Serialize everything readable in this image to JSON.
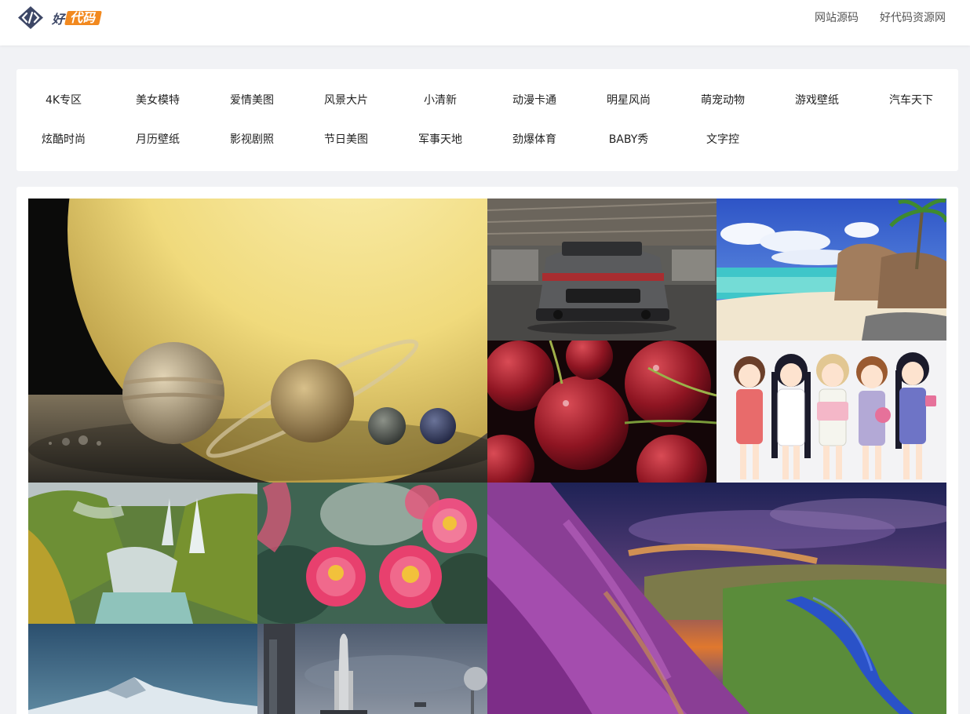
{
  "header": {
    "logo_part1": "好",
    "logo_part2": "代码",
    "nav": [
      "网站源码",
      "好代码资源网"
    ]
  },
  "categories": [
    "4K专区",
    "美女模特",
    "爱情美图",
    "风景大片",
    "小清新",
    "动漫卡通",
    "明星风尚",
    "萌宠动物",
    "游戏壁纸",
    "汽车天下",
    "炫酷时尚",
    "月历壁纸",
    "影视剧照",
    "节日美图",
    "军事天地",
    "劲爆体育",
    "BABY秀",
    "文字控"
  ],
  "gallery": {
    "images": [
      "planets-wallpaper",
      "sports-car-wallpaper",
      "tropical-beach-wallpaper",
      "cherries-wallpaper",
      "anime-girls-wallpaper",
      "waterfall-wallpaper",
      "pink-camellia-wallpaper",
      "purple-hillside-river-wallpaper",
      "snowy-mountain-wallpaper",
      "space-shuttle-wallpaper"
    ]
  },
  "colors": {
    "page_bg": "#f1f2f5",
    "logo_orange": "#f2891f",
    "logo_dark": "#3d4766"
  }
}
